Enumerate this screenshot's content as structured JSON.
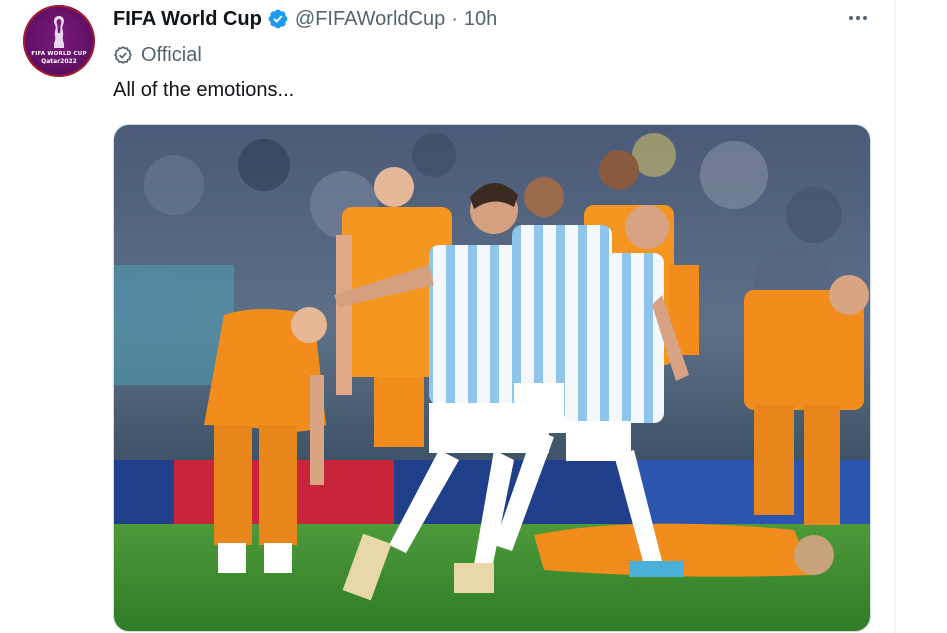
{
  "account": {
    "name": "FIFA World Cup",
    "handle": "@FIFAWorldCup",
    "separator": "·",
    "time": "10h",
    "label": "Official",
    "avatar_text_line1": "FIFA WORLD CUP",
    "avatar_text_line2": "Qatar2022"
  },
  "tweet": {
    "text": "All of the emotions..."
  },
  "icons": {
    "verified": "verified-badge-icon",
    "official": "official-check-circle-icon",
    "more": "more-options-icon"
  },
  "colors": {
    "verified_blue": "#1d9bf0",
    "text_primary": "#0f1419",
    "text_secondary": "#536471",
    "avatar_purple": "#5c0f60",
    "avatar_ring": "#a41c2c",
    "argentina_blue": "#8ec5ea",
    "netherlands_orange": "#f28c1c",
    "pitch_green": "#3c8a2e"
  }
}
